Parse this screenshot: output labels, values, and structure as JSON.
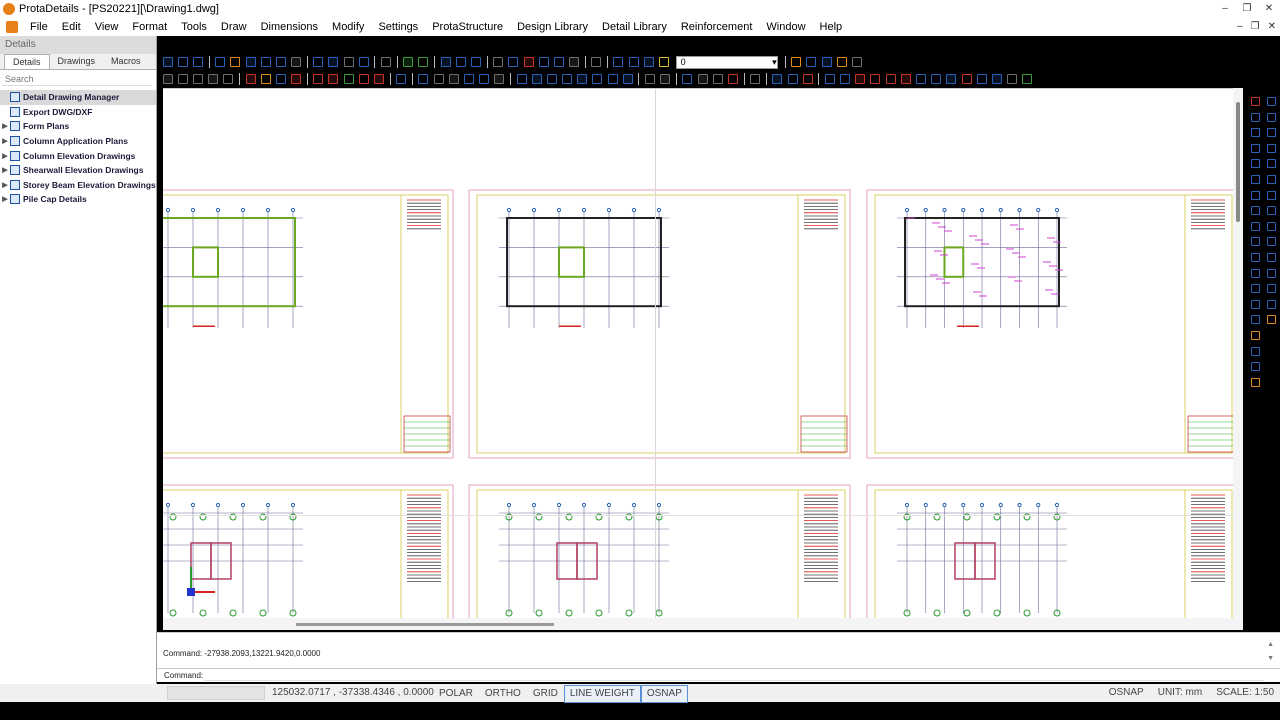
{
  "app": {
    "title": "ProtaDetails - [PS20221][\\Drawing1.dwg]"
  },
  "window_controls": [
    "–",
    "❐",
    "✕"
  ],
  "mdi_controls": [
    "–",
    "❐",
    "✕"
  ],
  "menu": {
    "items": [
      "File",
      "Edit",
      "View",
      "Format",
      "Tools",
      "Draw",
      "Dimensions",
      "Modify",
      "Settings",
      "ProtaStructure",
      "Design Library",
      "Detail Library",
      "Reinforcement",
      "Window",
      "Help"
    ]
  },
  "left_panel": {
    "header": "Details",
    "tabs": [
      "Details",
      "Drawings",
      "Macros"
    ],
    "search_placeholder": "Search",
    "tree": [
      {
        "label": "Detail Drawing Manager",
        "expandable": false,
        "selected": true
      },
      {
        "label": "Export DWG/DXF",
        "expandable": false,
        "selected": false
      },
      {
        "label": "Form Plans",
        "expandable": true,
        "selected": false
      },
      {
        "label": "Column Application Plans",
        "expandable": true,
        "selected": false
      },
      {
        "label": "Column Elevation Drawings",
        "expandable": true,
        "selected": false
      },
      {
        "label": "Shearwall Elevation Drawings",
        "expandable": true,
        "selected": false
      },
      {
        "label": "Storey Beam Elevation Drawings",
        "expandable": true,
        "selected": false
      },
      {
        "label": "Pile Cap Details",
        "expandable": true,
        "selected": false
      }
    ]
  },
  "toolbar": {
    "layer_value": "0",
    "colors": {
      "blue": "#2a5fb8",
      "red": "#c8322a",
      "green": "#3c9a3c",
      "orange": "#e08a1c",
      "gray": "#6e6e6e",
      "yellow": "#d9b82a"
    }
  },
  "command": {
    "history": "Command: -27938.2093,13221.9420,0.0000",
    "label": "Command:",
    "value": ""
  },
  "status": {
    "coords": "125032.0717 , -37338.4346 , 0.0000",
    "toggles": [
      {
        "label": "POLAR",
        "on": false
      },
      {
        "label": "ORTHO",
        "on": false
      },
      {
        "label": "GRID",
        "on": false
      },
      {
        "label": "LINE WEIGHT",
        "on": true
      },
      {
        "label": "OSNAP",
        "on": true
      }
    ],
    "right": [
      "OSNAP",
      "UNIT:  mm",
      "SCALE:  1:50"
    ]
  }
}
